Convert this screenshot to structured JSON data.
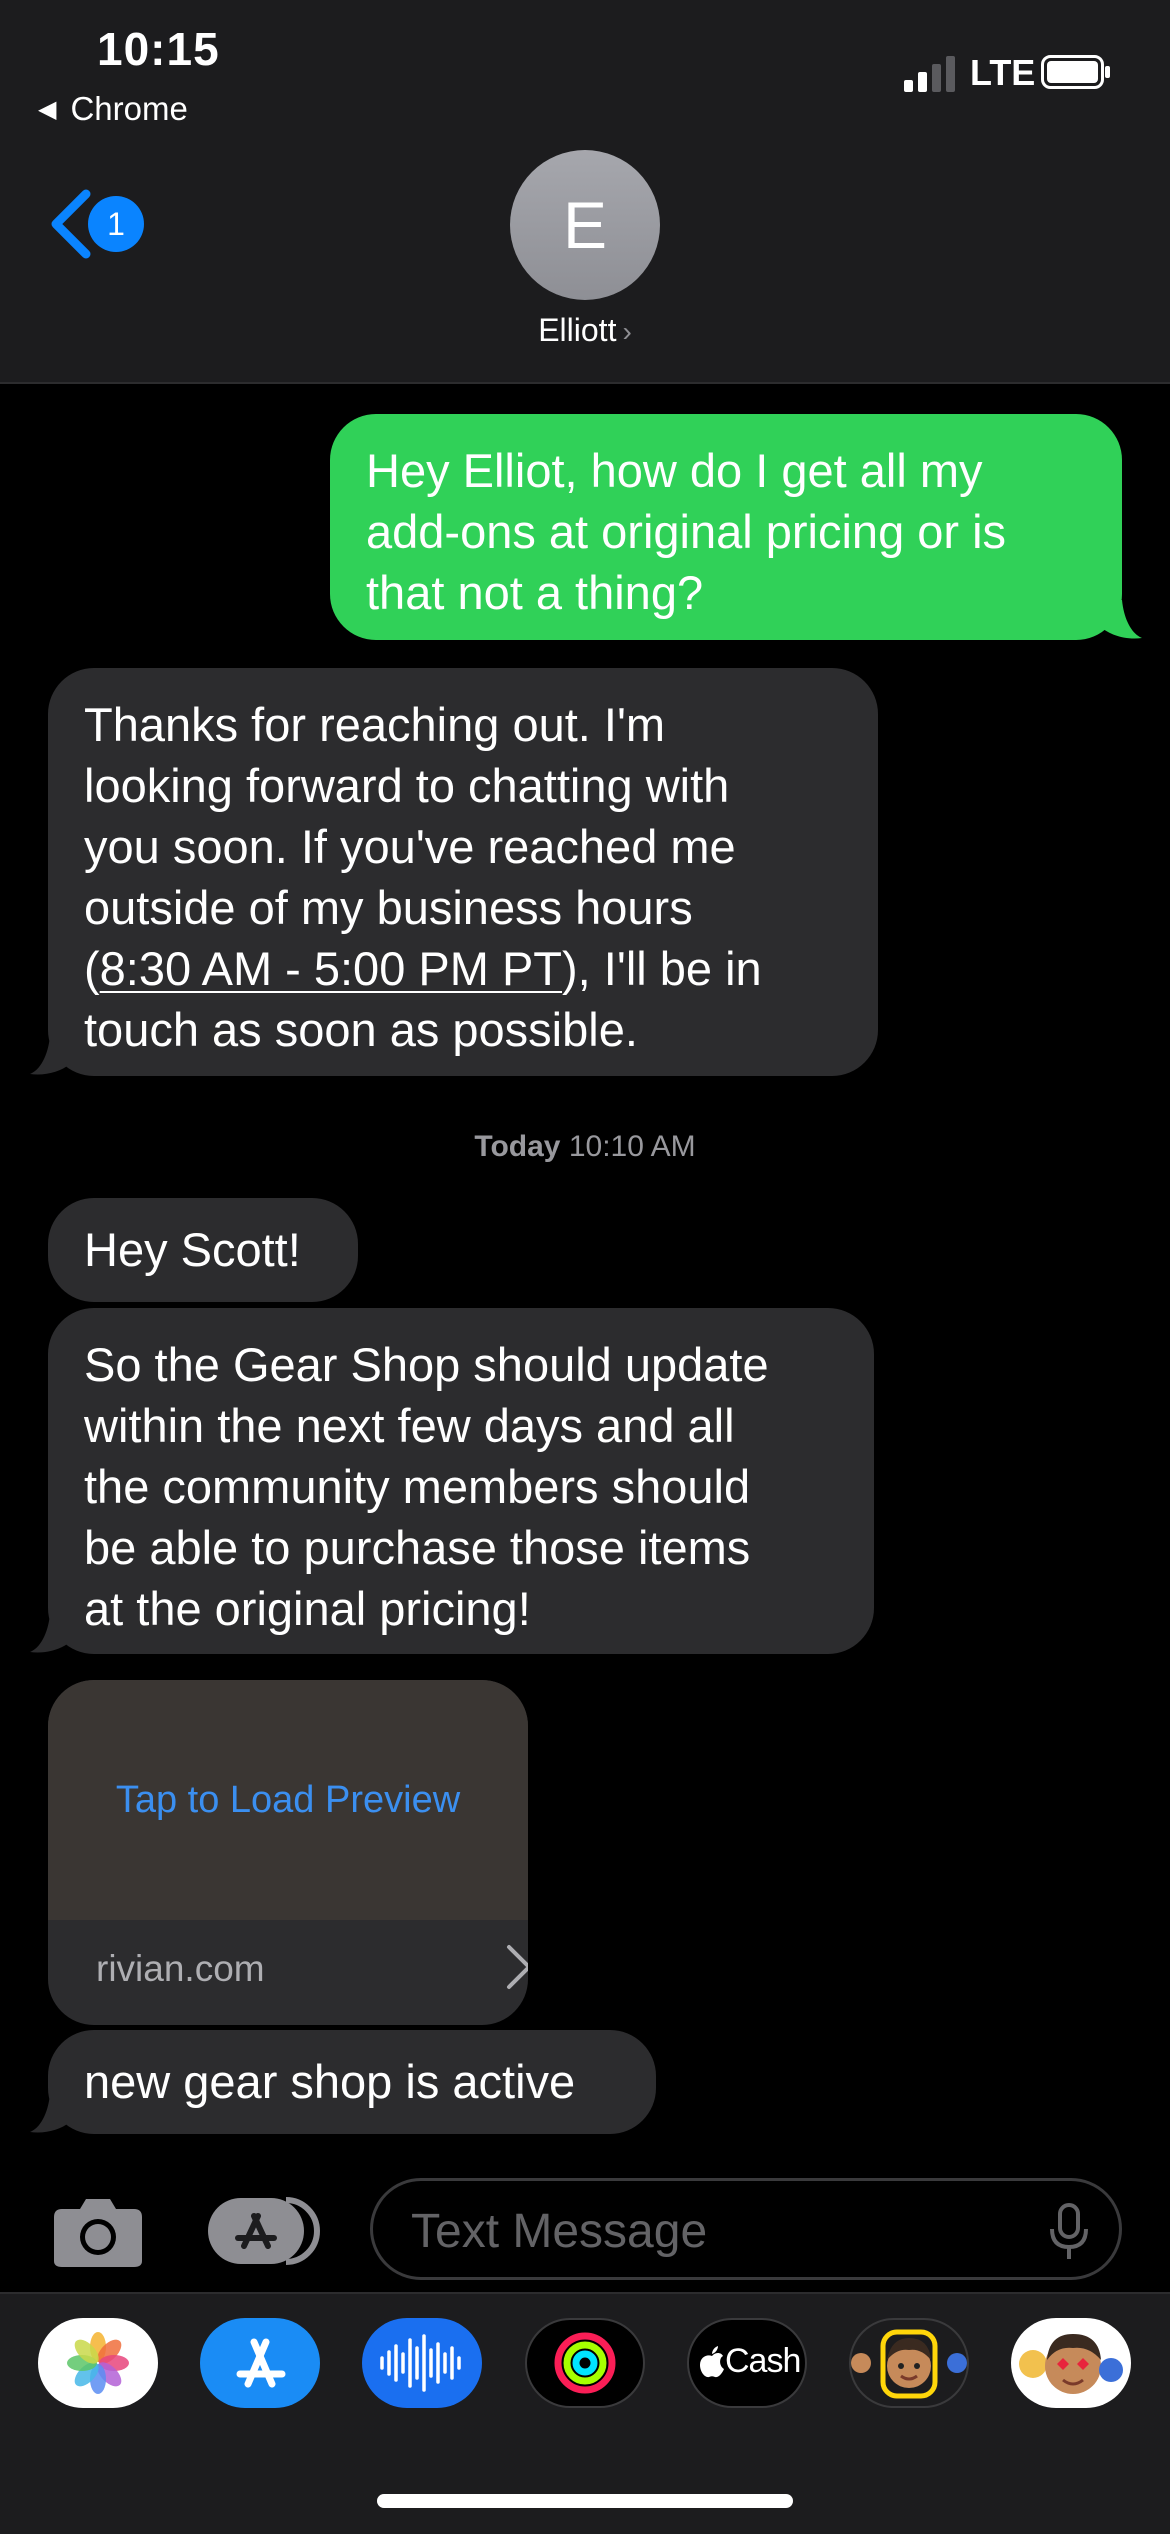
{
  "status_bar": {
    "time": "10:15",
    "back_app": "Chrome",
    "network": "LTE"
  },
  "nav": {
    "unread_count": "1",
    "contact_initial": "E",
    "contact_name": "Elliott",
    "chevron": "›"
  },
  "messages": [
    {
      "direction": "outgoing",
      "text": "Hey Elliot, how do I get all my\nadd-ons at original pricing or is\nthat not a thing?"
    },
    {
      "direction": "incoming",
      "text_before": "Thanks for reaching out. I'm\nlooking forward to chatting with\nyou soon. If you've reached me\noutside of my business hours\n(",
      "link": "8:30 AM - 5:00 PM PT",
      "text_after": "), I'll be in\ntouch as soon as possible."
    },
    {
      "direction": "incoming",
      "text": "Hey Scott!"
    },
    {
      "direction": "incoming",
      "text": "So the Gear Shop should update\nwithin the next few days and all\nthe community members should\nbe able to purchase those items\nat the original pricing!"
    },
    {
      "direction": "incoming",
      "text": "new gear shop is active"
    }
  ],
  "timestamp": {
    "day": "Today",
    "time": "10:10 AM"
  },
  "link_preview": {
    "action": "Tap to Load Preview",
    "domain": "rivian.com"
  },
  "input": {
    "placeholder": "Text Message"
  },
  "app_drawer": {
    "cash_label": "Cash",
    "apps": [
      "photos-icon",
      "app-store-icon",
      "audio-message-icon",
      "activity-icon",
      "apple-cash-icon",
      "memoji-icon",
      "memoji-stickers-icon"
    ]
  },
  "colors": {
    "outgoing_bubble": "#30d158",
    "incoming_bubble": "#2c2c2e",
    "accent": "#0a84ff",
    "background": "#000000"
  }
}
